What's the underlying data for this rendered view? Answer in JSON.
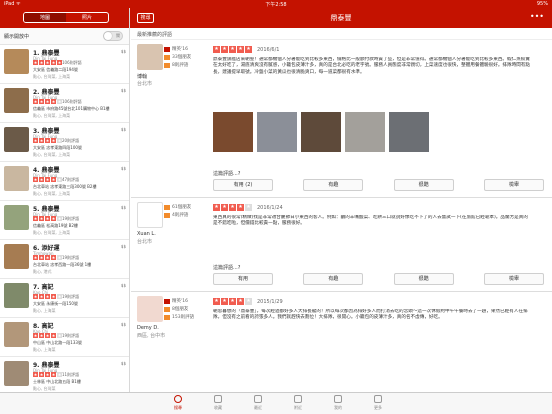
{
  "statusbar": {
    "left": "iPad ᯤ",
    "time": "下午2:58",
    "right": "95%"
  },
  "left": {
    "segments": [
      "地圖",
      "照片"
    ],
    "open_now_label": "顯示開放中",
    "toggle_label": "關",
    "businesses": [
      {
        "name": "1. 鼎泰豐",
        "en": "Din Tai Fung",
        "count": "106則評語",
        "addr": "大安區 信義路二段194號",
        "cat": "點心, 台灣菜, 上海菜",
        "price": "$$",
        "stars": 5,
        "color": "#b58a5a"
      },
      {
        "name": "2. 鼎泰豐",
        "en": "Din Tai Fung",
        "count": "106則評語",
        "addr": "信義區 市府路45號台北101購物中心 B1樓",
        "cat": "點心, 台灣菜, 上海菜",
        "price": "$$",
        "stars": 4,
        "color": "#8d6d4b"
      },
      {
        "name": "3. 鼎泰豐",
        "en": "Din Tai Fung",
        "count": "20則評語",
        "addr": "大安區 忠孝東路四段100號",
        "cat": "點心, 台灣菜, 上海菜",
        "price": "$$",
        "stars": 4,
        "color": "#6b5a48"
      },
      {
        "name": "4. 鼎泰豐",
        "en": "Din Tai Fung",
        "count": "47則評語",
        "addr": "台北車站 忠孝東路三段300號 B2樓",
        "cat": "點心, 台灣菜, 上海菜",
        "price": "$$",
        "stars": 4,
        "color": "#c9b7a0"
      },
      {
        "name": "5. 鼎泰豐",
        "en": "Din Tai Fung",
        "count": "19則評語",
        "addr": "信義區 松高路19號 B2樓",
        "cat": "點心, 台灣菜, 上海菜",
        "price": "$$",
        "stars": 4,
        "color": "#94a37c"
      },
      {
        "name": "6. 添好運",
        "en": "Timhowan",
        "count": "19則評語",
        "addr": "台北車站 忠孝西路一段36號 1樓",
        "cat": "點心, 港式",
        "price": "$$",
        "stars": 4,
        "color": "#a67c52"
      },
      {
        "name": "7. 高記",
        "en": "Kao Chi",
        "count": "19則評語",
        "addr": "大安區 永康街一段150號",
        "cat": "點心, 上海菜",
        "price": "$$",
        "stars": 4,
        "color": "#7f8a6a"
      },
      {
        "name": "8. 高記",
        "en": "Kao Chi",
        "count": "19則評語",
        "addr": "中山區 中山北路一段133號",
        "cat": "點心, 上海菜",
        "price": "$$",
        "stars": 4,
        "color": "#b2977a"
      },
      {
        "name": "9. 鼎泰豐",
        "en": "Din Tai Fung",
        "count": "11則評語",
        "addr": "士林區 中山北路五段 B1樓",
        "cat": "點心, 台灣菜",
        "price": "$$",
        "stars": 4,
        "color": "#9f8b75"
      }
    ]
  },
  "nav": {
    "back": "搜尋",
    "title": "鼎泰豐",
    "more": "•••"
  },
  "main": {
    "section_title": "最新推薦的評語",
    "reviews": [
      {
        "user": "博翰",
        "city": "台北市",
        "elite": "精英'16",
        "friends": "33個朋友",
        "reviews": "8則評語",
        "date": "2016/6/1",
        "stars": 5,
        "avatar": "#d9c4b0",
        "text": "鼎泰豐旗艦店來朝聖！通常都機個人分著能吃到比較多東西，價格比一般額付款時貴了些，但是非常值得。通常都機個人分著能吃到比較多東西。蝦仁蒸餃實在太好吃了，湯底清爽沒有膩感，小籠包皮薄汁多，真的是台北必吃的老字號。服務人員態度非常親切，上菜速度也很快，整體用餐體驗很好。排隊時間有點長，建議提早取號。冷盤小菜的黃瓜也很清脆爽口，每一道菜都很有水準。",
        "photos": [
          "#7a4a2e",
          "#8b8f98",
          "#5e4a3a",
          "#a3a09b",
          "#6c6f74"
        ],
        "ask": "這篇評語...?",
        "buttons": [
          "有用 (2)",
          "有趣",
          "很酷",
          "檢舉"
        ]
      },
      {
        "user": "Xuan L.",
        "city": "台北市",
        "elite": "",
        "friends": "61個朋友",
        "reviews": "4則評語",
        "date": "2016/1/24",
        "stars": 4,
        "avatar": "#ffffff",
        "text": "東西真的很常(精緻)找是非常適合慶節日小東西的客人。例如：鹹的羊嘴酸菜、吃餅三口就說好像吃不下了的人去嘗試一下(在旅館已經靠本)。品蘭芳是真的是不錯吃啦，但價錢比較貴一點，服務很好。",
        "photos": [],
        "ask": "這篇評語...?",
        "buttons": [
          "有用",
          "有趣",
          "很酷",
          "檢舉"
        ]
      },
      {
        "user": "Demy D.",
        "city": "西區, 台中市",
        "elite": "精英'16",
        "friends": "8個朋友",
        "reviews": "153則評語",
        "date": "2015/1/29",
        "stars": 4,
        "avatar": "#f1d9d0",
        "text": "朝思暮想的「鼎泰豐」，每次經過都好多人大排長龍的！所以每次都因為排好多人而打消去吃的念頭～這一次休假約中午午餐時去了一趟，果然已經有人在排隊，但沒有之前看的誇張多人。我們就趕快去劃位！大排隊，很開心。小籠包的皮薄汁多，真的名不虛傳，好吃。",
        "photos": [],
        "ask": "",
        "buttons": []
      }
    ]
  },
  "tabbar": [
    "搜尋",
    "收藏",
    "最近",
    "附近",
    "我的",
    "更多"
  ]
}
